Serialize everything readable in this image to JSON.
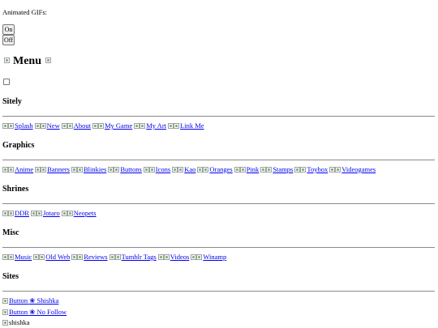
{
  "intro_label": "Animated GIFs:",
  "buttons": {
    "on": "On",
    "off": "Off"
  },
  "menu_title": "Menu",
  "sections": [
    {
      "heading": "Sitely",
      "links": [
        "Splash",
        "New",
        "About",
        "My Game",
        "My Art",
        "Link Me"
      ]
    },
    {
      "heading": "Graphics",
      "links": [
        "Anime",
        "Banners",
        "Blinkies",
        "Buttons",
        "Icons",
        "Kao",
        "Oranges",
        "Pink",
        "Stamps",
        "Toybox",
        "Videogames"
      ]
    },
    {
      "heading": "Shrines",
      "links": [
        "DDR",
        "Jotaro",
        "Neopets"
      ]
    },
    {
      "heading": "Misc",
      "links": [
        "Music",
        "Old Web",
        "Reviews",
        "Tumblr Tags",
        "Videos",
        "Winamp"
      ]
    },
    {
      "heading": "Sites",
      "links": []
    }
  ],
  "sites": [
    {
      "alt": "Button",
      "label": "❀ Shishka"
    },
    {
      "alt": "Button",
      "label": "❀ No Follow"
    },
    {
      "alt": "shishka",
      "label": ""
    }
  ]
}
